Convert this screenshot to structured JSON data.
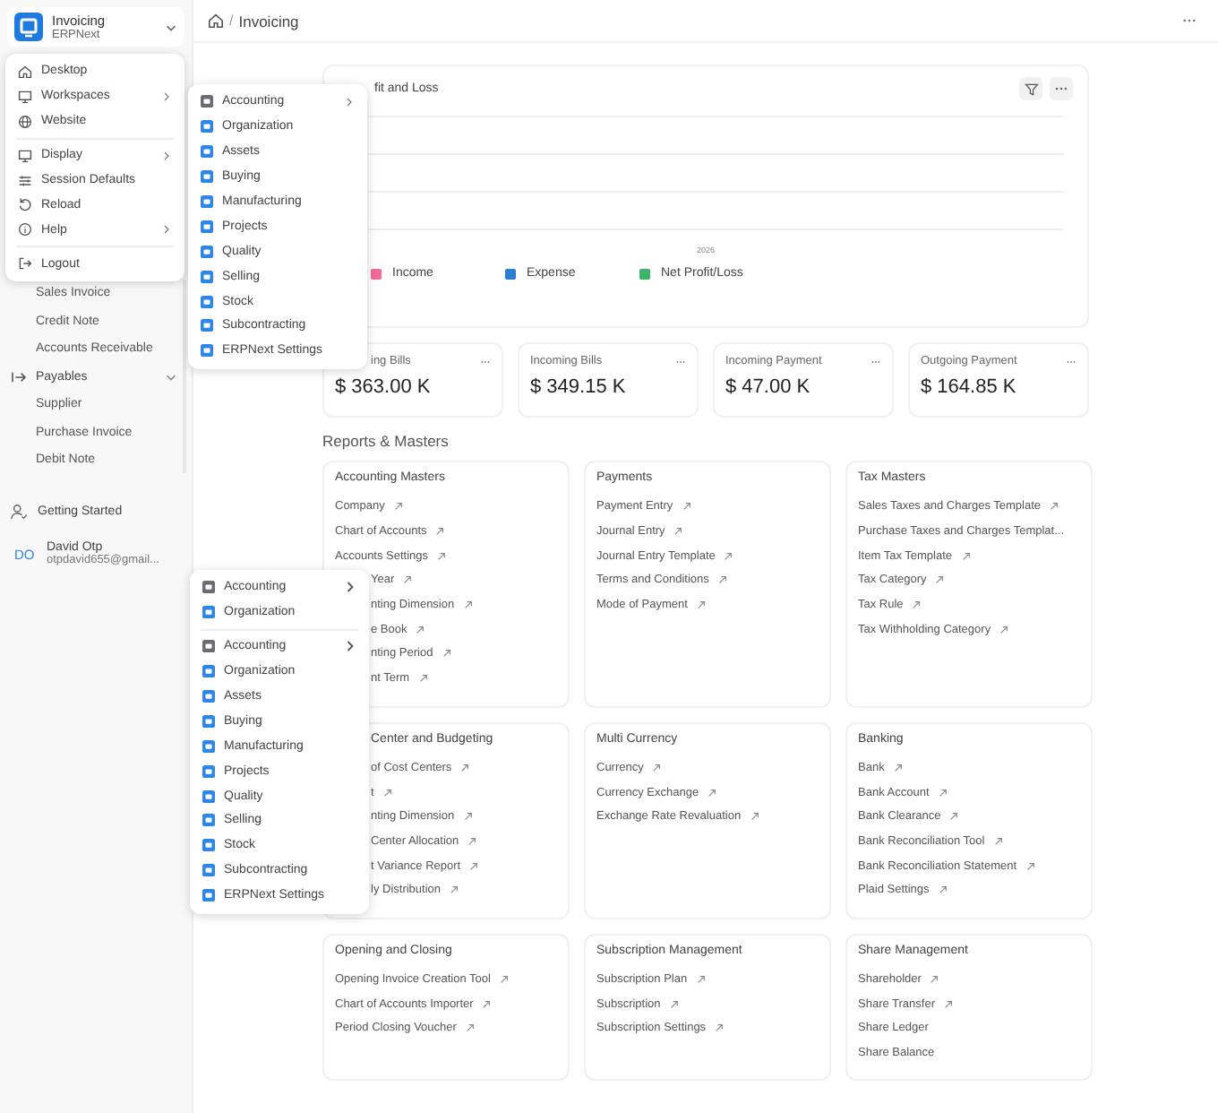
{
  "sidebar": {
    "app": {
      "title": "Invoicing",
      "subtitle": "ERPNext"
    },
    "sections": [
      {
        "items": [
          "Sales Invoice",
          "Credit Note",
          "Accounts Receivable"
        ]
      },
      {
        "label": "Payables",
        "expanded": true,
        "items": [
          "Supplier",
          "Purchase Invoice",
          "Debit Note"
        ]
      }
    ],
    "getting_started": "Getting Started",
    "user": {
      "initials": "DO",
      "name": "David Otp",
      "email": "otpdavid655@gmail..."
    }
  },
  "breadcrumb": {
    "separator": "/",
    "page": "Invoicing"
  },
  "chart_card": {
    "title": "fit and Loss",
    "title_partial": true,
    "x_label": "2026",
    "legend": [
      {
        "label": "Income",
        "color": "#f06b9a"
      },
      {
        "label": "Expense",
        "color": "#2d7dd2"
      },
      {
        "label": "Net Profit/Loss",
        "color": "#3fb56b"
      }
    ]
  },
  "number_cards": [
    {
      "label": "ing Bills",
      "partial": true,
      "value": "$ 363.00 K"
    },
    {
      "label": "Incoming Bills",
      "partial": false,
      "value": "$ 349.15 K"
    },
    {
      "label": "Incoming Payment",
      "partial": false,
      "value": "$ 47.00 K"
    },
    {
      "label": "Outgoing Payment",
      "partial": false,
      "value": "$ 164.85 K"
    }
  ],
  "section_title": "Reports & Masters",
  "cards": [
    {
      "title": "Accounting Masters",
      "partial": false,
      "links": [
        {
          "label": "Company",
          "external": true,
          "partial": false
        },
        {
          "label": "Chart of Accounts",
          "external": true,
          "partial": false
        },
        {
          "label": "Accounts Settings",
          "external": true,
          "partial": false
        },
        {
          "label": "Year",
          "external": true,
          "partial": true
        },
        {
          "label": "nting Dimension",
          "external": true,
          "partial": true
        },
        {
          "label": "e Book",
          "external": true,
          "partial": true
        },
        {
          "label": "nting Period",
          "external": true,
          "partial": true
        },
        {
          "label": "nt Term",
          "external": true,
          "partial": true
        }
      ]
    },
    {
      "title": "Payments",
      "partial": false,
      "links": [
        {
          "label": "Payment Entry",
          "external": true,
          "partial": false
        },
        {
          "label": "Journal Entry",
          "external": true,
          "partial": false
        },
        {
          "label": "Journal Entry Template",
          "external": true,
          "partial": false
        },
        {
          "label": "Terms and Conditions",
          "external": true,
          "partial": false
        },
        {
          "label": "Mode of Payment",
          "external": true,
          "partial": false
        }
      ]
    },
    {
      "title": "Tax Masters",
      "partial": false,
      "links": [
        {
          "label": "Sales Taxes and Charges Template",
          "external": true,
          "partial": false
        },
        {
          "label": "Purchase Taxes and Charges Templat...",
          "external": false,
          "partial": false
        },
        {
          "label": "Item Tax Template",
          "external": true,
          "partial": false
        },
        {
          "label": "Tax Category",
          "external": true,
          "partial": false
        },
        {
          "label": "Tax Rule",
          "external": true,
          "partial": false
        },
        {
          "label": "Tax Withholding Category",
          "external": true,
          "partial": false
        }
      ]
    },
    {
      "title": "Center and Budgeting",
      "partial": true,
      "links": [
        {
          "label": "of Cost Centers",
          "external": true,
          "partial": true
        },
        {
          "label": "t",
          "external": true,
          "partial": true
        },
        {
          "label": "nting Dimension",
          "external": true,
          "partial": true
        },
        {
          "label": "Center Allocation",
          "external": true,
          "partial": true
        },
        {
          "label": "t Variance Report",
          "external": true,
          "partial": true
        },
        {
          "label": "ly Distribution",
          "external": true,
          "partial": true
        }
      ]
    },
    {
      "title": "Multi Currency",
      "partial": false,
      "links": [
        {
          "label": "Currency",
          "external": true,
          "partial": false
        },
        {
          "label": "Currency Exchange",
          "external": true,
          "partial": false
        },
        {
          "label": "Exchange Rate Revaluation",
          "external": true,
          "partial": false
        }
      ]
    },
    {
      "title": "Banking",
      "partial": false,
      "links": [
        {
          "label": "Bank",
          "external": true,
          "partial": false
        },
        {
          "label": "Bank Account",
          "external": true,
          "partial": false
        },
        {
          "label": "Bank Clearance",
          "external": true,
          "partial": false
        },
        {
          "label": "Bank Reconciliation Tool",
          "external": true,
          "partial": false
        },
        {
          "label": "Bank Reconciliation Statement",
          "external": true,
          "partial": false
        },
        {
          "label": "Plaid Settings",
          "external": true,
          "partial": false
        }
      ]
    },
    {
      "title": "Opening and Closing",
      "partial": false,
      "links": [
        {
          "label": "Opening Invoice Creation Tool",
          "external": true,
          "partial": false
        },
        {
          "label": "Chart of Accounts Importer",
          "external": true,
          "partial": false
        },
        {
          "label": "Period Closing Voucher",
          "external": true,
          "partial": false
        }
      ]
    },
    {
      "title": "Subscription Management",
      "partial": false,
      "links": [
        {
          "label": "Subscription Plan",
          "external": true,
          "partial": false
        },
        {
          "label": "Subscription",
          "external": true,
          "partial": false
        },
        {
          "label": "Subscription Settings",
          "external": true,
          "partial": false
        }
      ]
    },
    {
      "title": "Share Management",
      "partial": false,
      "links": [
        {
          "label": "Shareholder",
          "external": true,
          "partial": false
        },
        {
          "label": "Share Transfer",
          "external": true,
          "partial": false
        },
        {
          "label": "Share Ledger",
          "external": false,
          "partial": false
        },
        {
          "label": "Share Balance",
          "external": false,
          "partial": false
        }
      ]
    }
  ],
  "user_menu": {
    "groups": [
      [
        {
          "label": "Desktop",
          "has_submenu": false
        },
        {
          "label": "Workspaces",
          "has_submenu": true
        },
        {
          "label": "Website",
          "has_submenu": false
        }
      ],
      [
        {
          "label": "Display",
          "has_submenu": true
        },
        {
          "label": "Session Defaults",
          "has_submenu": false
        },
        {
          "label": "Reload",
          "has_submenu": false
        },
        {
          "label": "Help",
          "has_submenu": true
        }
      ],
      [
        {
          "label": "Logout",
          "has_submenu": false
        }
      ]
    ]
  },
  "workspaces_menu": {
    "items": [
      {
        "label": "Accounting",
        "color": "#6b6b73",
        "has_submenu": true
      },
      {
        "label": "Organization",
        "color": "#2e86e6",
        "has_submenu": false
      },
      {
        "label": "Assets",
        "color": "#2e86e6",
        "has_submenu": false
      },
      {
        "label": "Buying",
        "color": "#2e86e6",
        "has_submenu": false
      },
      {
        "label": "Manufacturing",
        "color": "#2e86e6",
        "has_submenu": false
      },
      {
        "label": "Projects",
        "color": "#2e86e6",
        "has_submenu": false
      },
      {
        "label": "Quality",
        "color": "#2e86e6",
        "has_submenu": false
      },
      {
        "label": "Selling",
        "color": "#2e86e6",
        "has_submenu": false
      },
      {
        "label": "Stock",
        "color": "#2e86e6",
        "has_submenu": false
      },
      {
        "label": "Subcontracting",
        "color": "#2e86e6",
        "has_submenu": false
      },
      {
        "label": "ERPNext Settings",
        "color": "#2e86e6",
        "has_submenu": false
      }
    ]
  },
  "ghost_menu": {
    "top_items": [
      {
        "label": "Accounting",
        "color": "#6b6b73",
        "kind": "submenu"
      },
      {
        "label": "Organization",
        "color": "#2e86e6",
        "kind": "item"
      }
    ],
    "items": [
      {
        "label": "Accounting",
        "color": "#6b6b73",
        "kind": "submenu"
      },
      {
        "label": "Organization",
        "color": "#2e86e6",
        "kind": "item"
      },
      {
        "label": "Assets",
        "color": "#2e86e6",
        "kind": "item"
      },
      {
        "label": "Buying",
        "color": "#2e86e6",
        "kind": "item"
      },
      {
        "label": "Manufacturing",
        "color": "#2e86e6",
        "kind": "item"
      },
      {
        "label": "Projects",
        "color": "#2e86e6",
        "kind": "item"
      },
      {
        "label": "Quality",
        "color": "#2e86e6",
        "kind": "item"
      },
      {
        "label": "Selling",
        "color": "#2e86e6",
        "kind": "item"
      },
      {
        "label": "Stock",
        "color": "#2e86e6",
        "kind": "item"
      },
      {
        "label": "Subcontracting",
        "color": "#2e86e6",
        "kind": "item"
      },
      {
        "label": "ERPNext Settings",
        "color": "#2e86e6",
        "kind": "item"
      }
    ]
  }
}
